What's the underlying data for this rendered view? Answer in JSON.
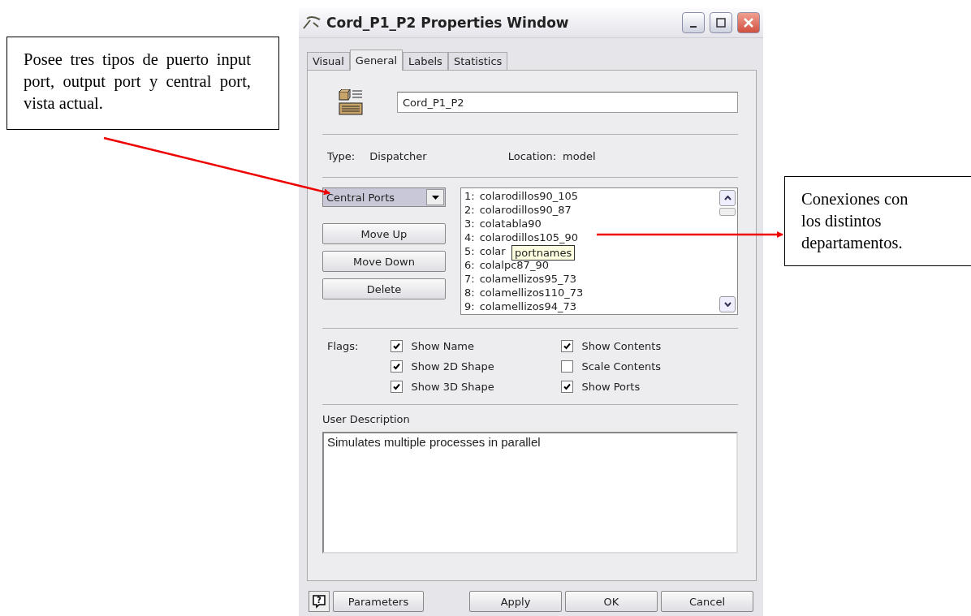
{
  "annotations": [
    {
      "text": "Posee tres tipos de puerto input port, output port y central port, vista actual."
    },
    {
      "text": "Conexiones con los distintos departamentos."
    }
  ],
  "window": {
    "title": "Cord_P1_P2  Properties Window"
  },
  "tabs": [
    {
      "label": "Visual",
      "selected": false
    },
    {
      "label": "General",
      "selected": true
    },
    {
      "label": "Labels",
      "selected": false
    },
    {
      "label": "Statistics",
      "selected": false
    }
  ],
  "name_field": {
    "value": "Cord_P1_P2"
  },
  "type": {
    "label": "Type:",
    "value": "Dispatcher"
  },
  "location": {
    "label": "Location:",
    "value": "model"
  },
  "port_selector": {
    "value": "Central Ports"
  },
  "port_buttons": [
    "Move Up",
    "Move Down",
    "Delete"
  ],
  "ports": [
    {
      "number": "1:",
      "name": "colarodillos90_105"
    },
    {
      "number": "2:",
      "name": "colarodillos90_87"
    },
    {
      "number": "3:",
      "name": "colatabla90"
    },
    {
      "number": "4:",
      "name": "colarodillos105_90"
    },
    {
      "number": "5:",
      "name": "colar"
    },
    {
      "number": "6:",
      "name": "colalpc87_90"
    },
    {
      "number": "7:",
      "name": "colamellizos95_73"
    },
    {
      "number": "8:",
      "name": "colamellizos110_73"
    },
    {
      "number": "9:",
      "name": "colamellizos94_73"
    }
  ],
  "tooltip": "portnames",
  "flags": {
    "label": "Flags:",
    "items": [
      {
        "label": "Show Name",
        "checked": true
      },
      {
        "label": "Show Contents",
        "checked": true
      },
      {
        "label": "Show 2D Shape",
        "checked": true
      },
      {
        "label": "Scale Contents",
        "checked": false
      },
      {
        "label": "Show 3D Shape",
        "checked": true
      },
      {
        "label": "Show Ports",
        "checked": true
      }
    ]
  },
  "user_description": {
    "label": "User Description",
    "value": "Simulates multiple processes in parallel"
  },
  "help_button": {
    "label": "?"
  },
  "buttons": [
    "Parameters",
    "Apply",
    "OK",
    "Cancel"
  ]
}
